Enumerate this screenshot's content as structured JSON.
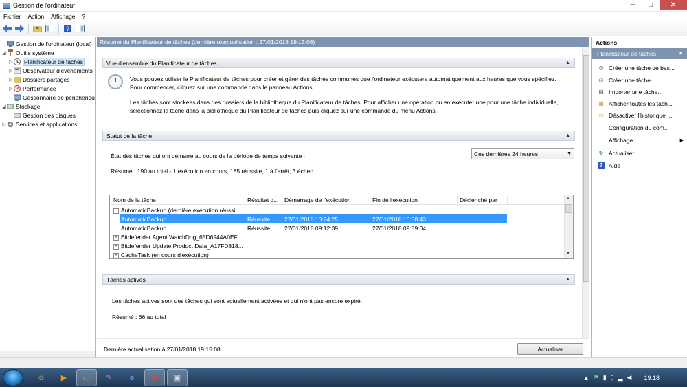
{
  "window": {
    "title": "Gestion de l'ordinateur",
    "controls": {
      "minimize": "─",
      "maximize": "□",
      "close": "✕"
    }
  },
  "menu": [
    "Fichier",
    "Action",
    "Affichage",
    "?"
  ],
  "toolbar": {
    "icons": [
      "back-arrow-icon",
      "forward-arrow-icon",
      "up-folder-icon",
      "show-hide-tree-icon",
      "help-icon",
      "show-hide-action-pane-icon"
    ]
  },
  "tree": [
    {
      "label": "Gestion de l'ordinateur (local)",
      "level": 0,
      "expander": "",
      "icon": "computer-icon"
    },
    {
      "label": "Outils système",
      "level": 1,
      "expander": "◢",
      "icon": "tools-icon"
    },
    {
      "label": "Planificateur de tâches",
      "level": 2,
      "expander": "▷",
      "icon": "clock-icon",
      "selected": true
    },
    {
      "label": "Observateur d'événements",
      "level": 2,
      "expander": "▷",
      "icon": "event-viewer-icon"
    },
    {
      "label": "Dossiers partagés",
      "level": 2,
      "expander": "▷",
      "icon": "shared-folder-icon"
    },
    {
      "label": "Performance",
      "level": 2,
      "expander": "▷",
      "icon": "performance-icon"
    },
    {
      "label": "Gestionnaire de périphériques",
      "level": 2,
      "expander": "",
      "icon": "device-manager-icon"
    },
    {
      "label": "Stockage",
      "level": 1,
      "expander": "◢",
      "icon": "storage-icon"
    },
    {
      "label": "Gestion des disques",
      "level": 2,
      "expander": "",
      "icon": "disk-icon"
    },
    {
      "label": "Services et applications",
      "level": 1,
      "expander": "▷",
      "icon": "services-icon"
    }
  ],
  "middle": {
    "header": "Résumé du Planificateur de tâches (dernière réactualisation : 27/01/2018 19:15:08)",
    "overview": {
      "title": "Vue d'ensemble du Planificateur de tâches",
      "lines": [
        "Vous pouvez utiliser le Planificateur de tâches pour créer et gérer des tâches communes que l'ordinateur exécutera automatiquement aux heures que vous spécifiez.",
        "Pour commencer, cliquez sur une commande dans le panneau Actions.",
        "Les tâches sont stockées dans des dossiers de la bibliothèque du Planificateur de tâches. Pour afficher une opération ou en exécuter une pour une tâche individuelle,",
        "sélectionnez la tâche dans la bibliothèque du Planificateur de tâches puis cliquez sur une commande du menu Actions."
      ]
    },
    "status": {
      "title": "Statut de la tâche",
      "period_label": "État des tâches qui ont démarré au cours de la période de temps suivante :",
      "period_value": "Ces dernières 24 heures",
      "summary": "Résumé : 190 au total - 1 exécution en cours, 185 réussite, 1 à l'arrêt, 3 échec",
      "columns": [
        "Nom de la tâche",
        "Résultat d...",
        "Démarrage de l'exécution",
        "Fin de l'exécution",
        "Déclenché par"
      ],
      "rows": [
        {
          "expander": "−",
          "name": "AutomaticBackup (dernière exécution réussi...",
          "result": "",
          "start": "",
          "end": "",
          "trigger": "",
          "indent": false,
          "selected": false
        },
        {
          "expander": "",
          "name": "AutomaticBackup",
          "result": "Réussite",
          "start": "27/01/2018 10:24:25",
          "end": "27/01/2018 16:58:43",
          "trigger": "",
          "indent": true,
          "selected": true
        },
        {
          "expander": "",
          "name": "AutomaticBackup",
          "result": "Réussite",
          "start": "27/01/2018 09:12:39",
          "end": "27/01/2018 09:59:04",
          "trigger": "",
          "indent": true,
          "selected": false
        },
        {
          "expander": "+",
          "name": "Bitdefender Agent WatchDog_65D6944A0EF...",
          "result": "",
          "start": "",
          "end": "",
          "trigger": "",
          "indent": false,
          "selected": false
        },
        {
          "expander": "+",
          "name": "Bitdefender Update Product Data_A17FD818...",
          "result": "",
          "start": "",
          "end": "",
          "trigger": "",
          "indent": false,
          "selected": false
        },
        {
          "expander": "+",
          "name": "CacheTask (en cours d'exécution)",
          "result": "",
          "start": "",
          "end": "",
          "trigger": "",
          "indent": false,
          "selected": false
        }
      ]
    },
    "active": {
      "title": "Tâches actives",
      "description": "Les tâches actives sont des tâches qui sont actuellement activées et qui n'ont pas encore expiré.",
      "summary": "Résumé : 66 au total"
    },
    "footer": {
      "last_update": "Dernière actualisation à 27/01/2018 19:15:08",
      "refresh_label": "Actualiser"
    }
  },
  "actions": {
    "title": "Actions",
    "section": "Planificateur de tâches",
    "items": [
      {
        "label": "Créer une tâche de bas...",
        "icon": "create-basic-task-icon",
        "glyph": "◷"
      },
      {
        "label": "Créer une tâche...",
        "icon": "create-task-icon",
        "glyph": "◶"
      },
      {
        "label": "Importer une tâche...",
        "icon": "import-task-icon",
        "glyph": "▤"
      },
      {
        "label": "Afficher toutes les tâch...",
        "icon": "show-all-tasks-icon",
        "glyph": "▦"
      },
      {
        "label": "Désactiver l'historique ...",
        "icon": "disable-history-icon",
        "glyph": "▭"
      },
      {
        "label": "Configuration du com...",
        "icon": "",
        "glyph": ""
      },
      {
        "label": "Affichage",
        "icon": "",
        "glyph": "",
        "submenu": true
      },
      {
        "label": "Actualiser",
        "icon": "refresh-icon",
        "glyph": "↻"
      },
      {
        "label": "Aide",
        "icon": "help-icon",
        "glyph": "?"
      }
    ]
  },
  "taskbar": {
    "clock": "19:18",
    "buttons": [
      {
        "name": "taskbar-explorer-smiley-icon",
        "glyph": "☺"
      },
      {
        "name": "taskbar-media-player-icon",
        "glyph": "▶"
      },
      {
        "name": "taskbar-file-explorer-icon",
        "glyph": "▭"
      },
      {
        "name": "taskbar-paint-icon",
        "glyph": "✎"
      },
      {
        "name": "taskbar-internet-explorer-icon",
        "glyph": "e"
      },
      {
        "name": "taskbar-chrome-icon",
        "glyph": "◉"
      },
      {
        "name": "taskbar-computer-management-icon",
        "glyph": "▣"
      }
    ],
    "tray": [
      "▲",
      "⚑",
      "▮",
      "▯",
      "▂",
      "◀"
    ]
  },
  "colors": {
    "pane_header": "#7d93b0",
    "selection": "#3399ff",
    "taskbar": "#1c3552"
  }
}
